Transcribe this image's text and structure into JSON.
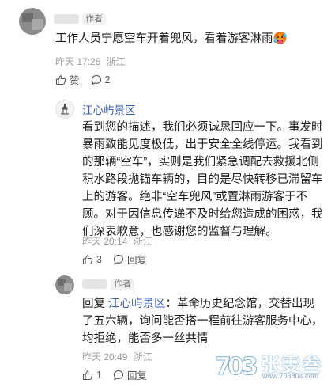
{
  "comments": [
    {
      "author_tag": "作者",
      "text": "工作人员宁愿空车开着兜风，看着游客淋雨🥵",
      "time": "昨天 17:25",
      "location": "浙江",
      "like_label": "赞",
      "reply_count": "2"
    },
    {
      "username": "江心屿景区",
      "text": "看到您的描述，我们必须诚恳回应一下。事发时暴雨致能见度极低，出于安全全线停运。我看到的那辆“空车”，实则是我们紧急调配去救援北侧积水路段抛锚车辆的，目的是尽快转移已滞留车上的游客。绝非“空车兜风”或置淋雨游客于不顾。对于因信息传递不及时给您造成的困惑，我们深表歉意，也感谢您的监督与理解。",
      "time": "昨天 20:14",
      "location": "浙江",
      "like_count": "3",
      "reply_label": "回复"
    },
    {
      "author_tag": "作者",
      "reply_prefix": "回复",
      "reply_to": "江心屿景区",
      "text": "：革命历史纪念馆，交替出现了五六辆，询问能否搭一程前往游客服务中心，均拒绝，能否多一丝共情",
      "time": "昨天 20:49",
      "location": "浙江",
      "like_count": "1",
      "reply_label": "回复"
    }
  ],
  "watermark": {
    "brand": "张雯叁",
    "url": "www.703804.com"
  },
  "colors": {
    "link": "#3b5ea8",
    "meta": "#9b9b9b"
  }
}
